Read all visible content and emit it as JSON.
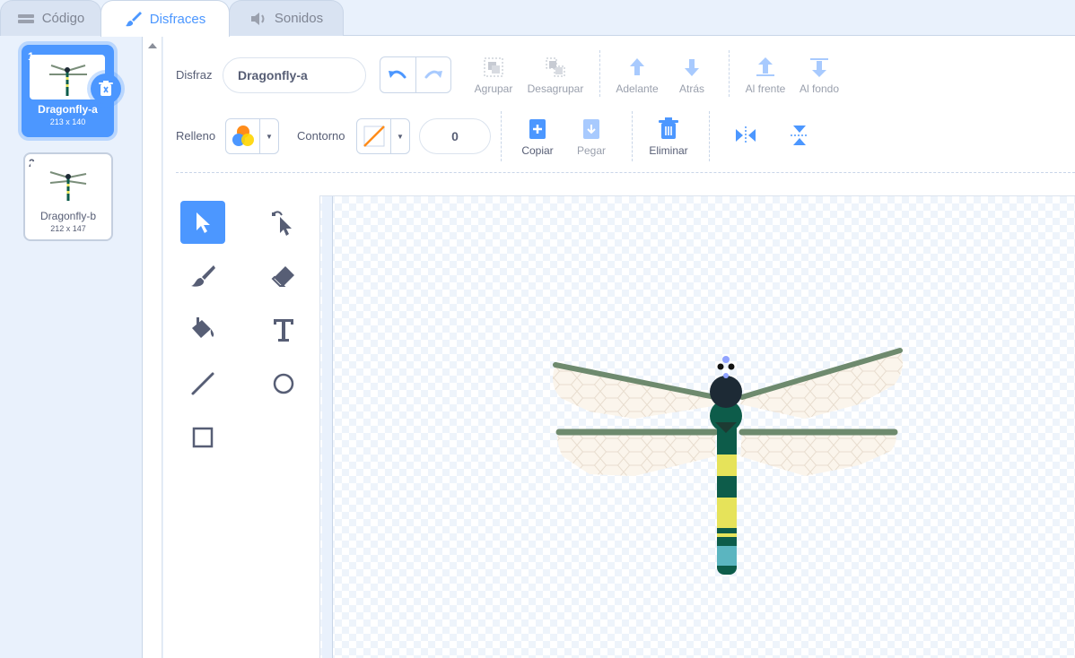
{
  "tabs": [
    {
      "label": "Código",
      "icon": "code-icon"
    },
    {
      "label": "Disfraces",
      "icon": "brush-icon"
    },
    {
      "label": "Sonidos",
      "icon": "speaker-icon"
    }
  ],
  "costumes": [
    {
      "index": "1",
      "name": "Dragonfly-a",
      "dims": "213 x 140",
      "selected": true
    },
    {
      "index": "2",
      "name": "Dragonfly-b",
      "dims": "212 x 147",
      "selected": false
    }
  ],
  "toolbar": {
    "costume_label": "Disfraz",
    "costume_name": "Dragonfly-a",
    "group": "Agrupar",
    "ungroup": "Desagrupar",
    "forward": "Adelante",
    "backward": "Atrás",
    "front": "Al frente",
    "back": "Al fondo",
    "fill_label": "Relleno",
    "outline_label": "Contorno",
    "outline_width": "0",
    "copy": "Copiar",
    "paste": "Pegar",
    "delete": "Eliminar"
  },
  "tools": [
    "select-tool",
    "reshape-tool",
    "brush-tool",
    "eraser-tool",
    "fill-tool",
    "text-tool",
    "line-tool",
    "circle-tool",
    "rectangle-tool"
  ],
  "colors": {
    "accent": "#4c97ff",
    "text": "#575e75",
    "wing_vein": "#6e8a6e",
    "body_dark": "#0d5c4a",
    "stripe_yellow": "#e6e35a",
    "tail_tip": "#5bb5c0"
  }
}
